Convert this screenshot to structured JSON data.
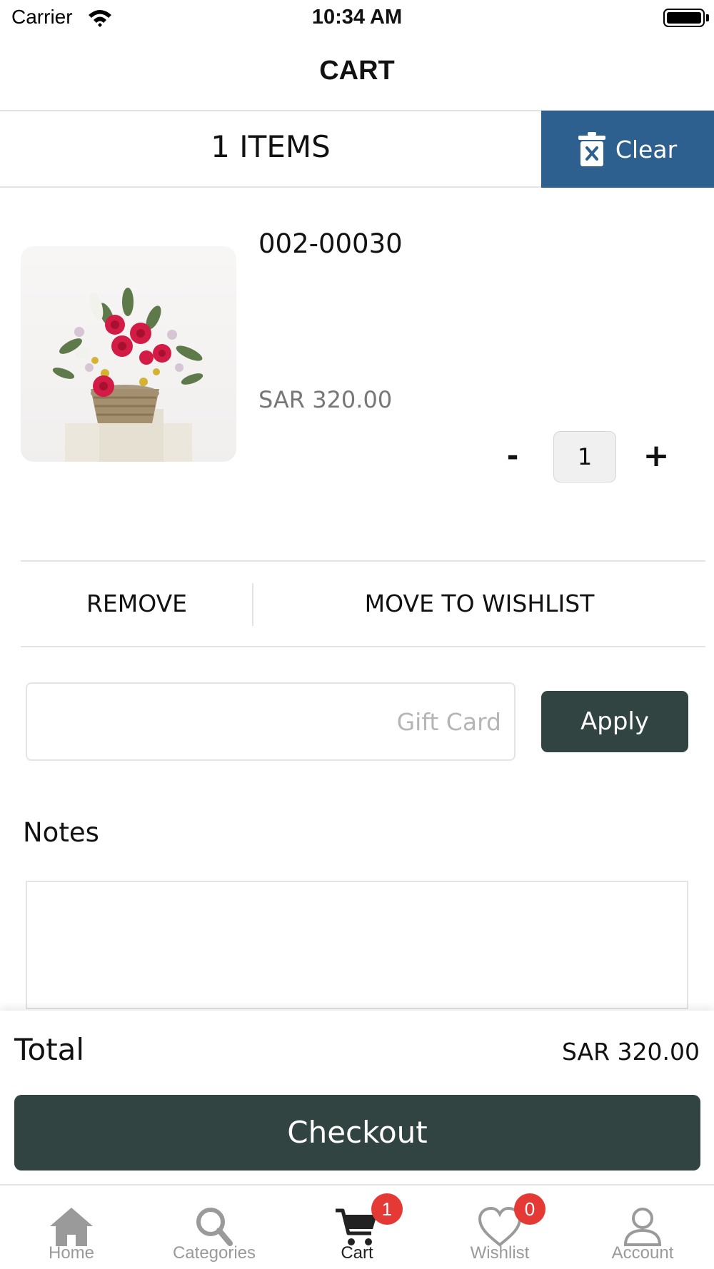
{
  "status_bar": {
    "carrier": "Carrier",
    "time": "10:34 AM"
  },
  "header": {
    "title": "CART"
  },
  "cart_summary": {
    "items_count": "1 ITEMS",
    "clear_label": "Clear"
  },
  "product": {
    "sku": "002-00030",
    "price": "SAR 320.00",
    "quantity": "1",
    "minus": "-",
    "plus": "+",
    "image_icon": "flower-basket-photo"
  },
  "actions": {
    "remove_label": "REMOVE",
    "move_to_wishlist_label": "MOVE TO WISHLIST"
  },
  "gift_card": {
    "placeholder": "Gift Card",
    "value": "",
    "apply_label": "Apply"
  },
  "notes": {
    "label": "Notes",
    "value": ""
  },
  "total": {
    "label": "Total",
    "value": "SAR 320.00",
    "checkout_label": "Checkout"
  },
  "tab_bar": {
    "tabs": [
      {
        "label": "Home",
        "icon": "home-icon"
      },
      {
        "label": "Categories",
        "icon": "search-icon"
      },
      {
        "label": "Cart",
        "icon": "cart-icon",
        "badge": "1"
      },
      {
        "label": "Wishlist",
        "icon": "heart-icon",
        "badge": "0"
      },
      {
        "label": "Account",
        "icon": "user-icon"
      }
    ]
  },
  "colors": {
    "clear_button": "#2d5f8f",
    "primary_dark": "#324442",
    "badge": "#e53935",
    "inactive_tab": "#9a9a9a"
  }
}
